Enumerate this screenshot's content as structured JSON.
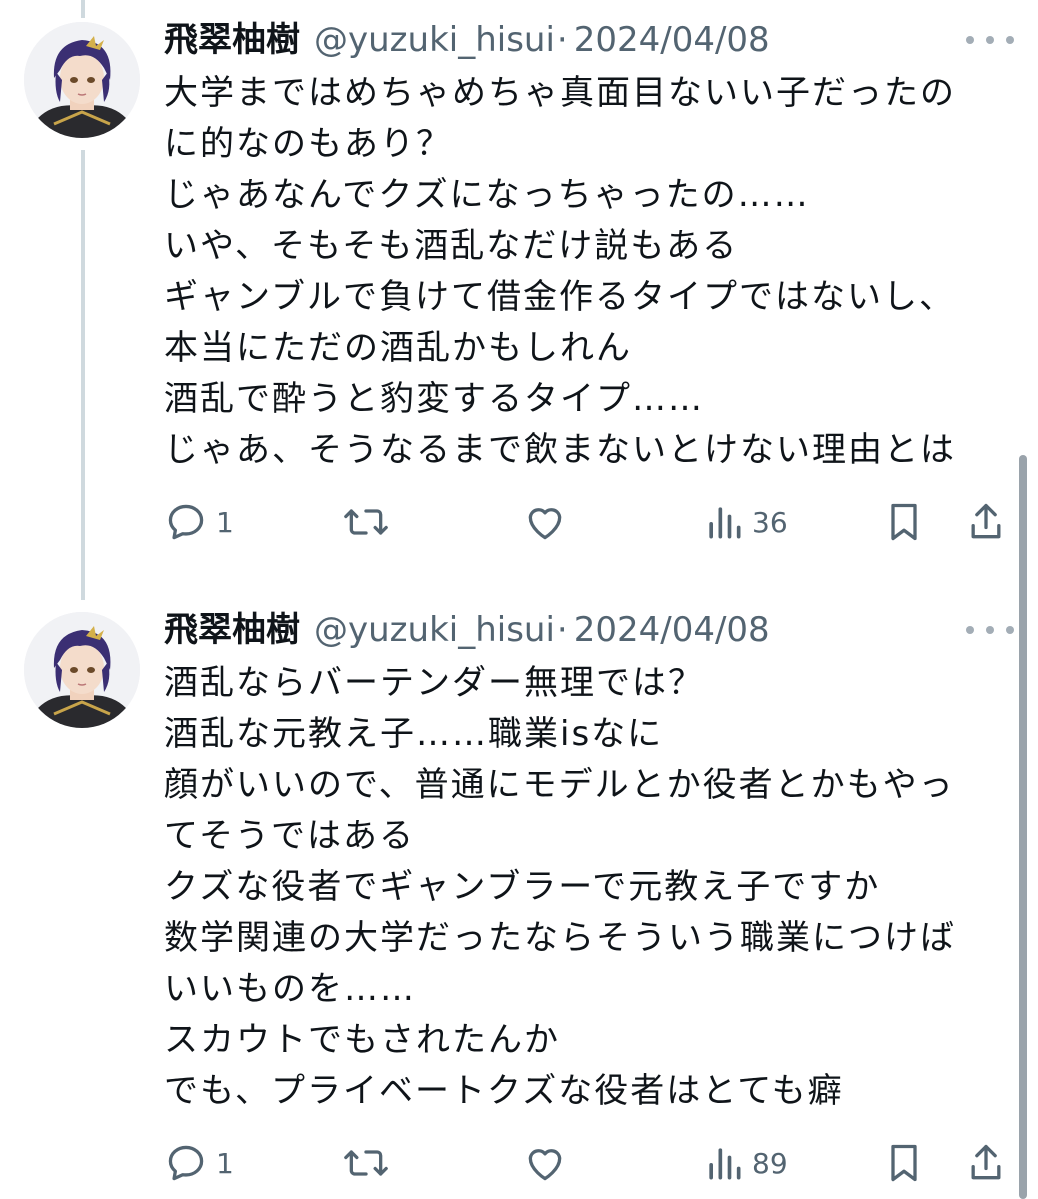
{
  "tweets": [
    {
      "author": {
        "name": "飛翠柚樹",
        "handle": "@yuzuki_hisui",
        "avatar": "avatar-image"
      },
      "separator": "·",
      "date": "2024/04/08",
      "lines": [
        "大学まではめちゃめちゃ真面目ないい子だったの",
        "に的なのもあり？",
        "じゃあなんでクズになっちゃったの……",
        "いや、そもそも酒乱なだけ説もある",
        "ギャンブルで負けて借金作るタイプではないし、",
        "本当にただの酒乱かもしれん",
        "酒乱で酔うと豹変するタイプ……",
        "じゃあ、そうなるまで飲まないとけない理由とは"
      ],
      "stats": {
        "replies": "1",
        "retweets": "",
        "likes": "",
        "views": "36"
      }
    },
    {
      "author": {
        "name": "飛翠柚樹",
        "handle": "@yuzuki_hisui",
        "avatar": "avatar-image"
      },
      "separator": "·",
      "date": "2024/04/08",
      "lines": [
        "酒乱ならバーテンダー無理では？",
        "酒乱な元教え子……職業isなに",
        "顔がいいので、普通にモデルとか役者とかもやっ",
        "てそうではある",
        "クズな役者でギャンブラーで元教え子ですか",
        "数学関連の大学だったならそういう職業につけば",
        "いいものを……",
        "スカウトでもされたんか",
        "でも、プライベートクズな役者はとても癖"
      ],
      "stats": {
        "replies": "1",
        "retweets": "",
        "likes": "",
        "views": "89"
      }
    }
  ],
  "icons": {
    "reply": "reply-icon",
    "retweet": "retweet-icon",
    "like": "heart-icon",
    "views": "views-icon",
    "bookmark": "bookmark-icon",
    "share": "share-icon",
    "more": "more-icon"
  },
  "colors": {
    "text": "#0f1419",
    "secondary": "#536471",
    "thread_line": "#cfd9de"
  }
}
